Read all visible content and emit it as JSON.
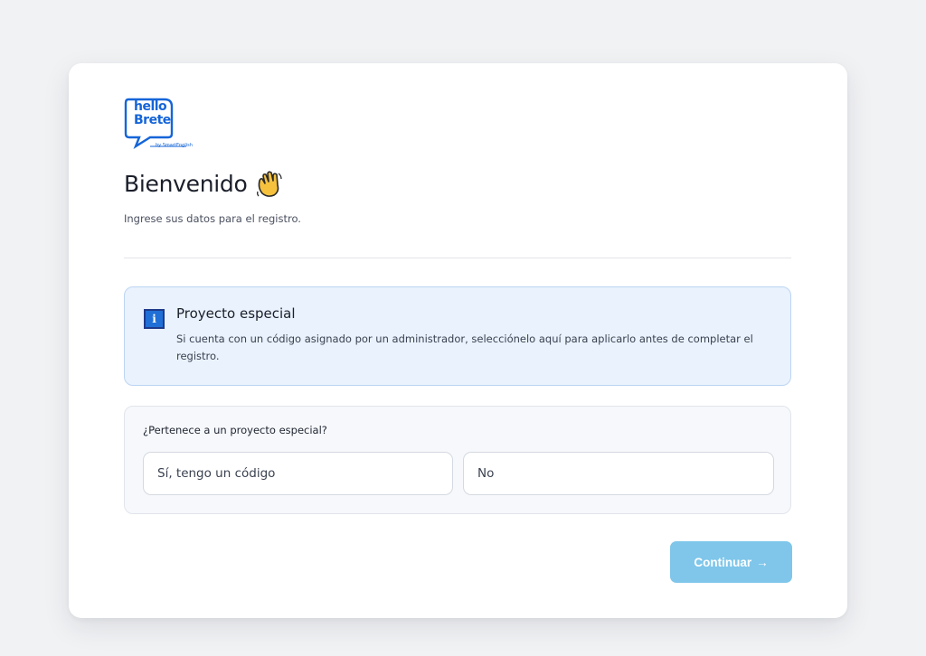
{
  "logo": {
    "line1": "hello",
    "line2": "Brete",
    "byline": "by SmartEnglish",
    "color": "#1565d8"
  },
  "header": {
    "title": "Bienvenido",
    "title_icon": "waving-hand-icon",
    "subtitle": "Ingrese sus datos para el registro."
  },
  "info": {
    "icon": "info-icon",
    "title": "Proyecto especial",
    "text": "Si cuenta con un código asignado por un administrador, selecciónelo aquí para aplicarlo antes de completar el registro."
  },
  "question": {
    "label": "¿Pertenece a un proyecto especial?",
    "options": [
      {
        "label": "Sí, tengo un código"
      },
      {
        "label": "No"
      }
    ]
  },
  "actions": {
    "continue_label": "Continuar",
    "continue_icon": "arrow-right-icon",
    "continue_arrow": "→",
    "continue_color": "#7fc6ea"
  }
}
